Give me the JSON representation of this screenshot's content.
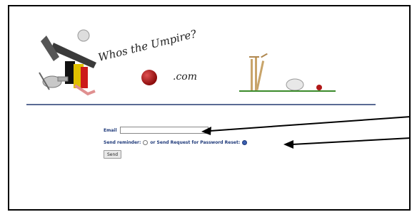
{
  "header": {
    "site_name": "Whos the Umpire?",
    "site_tld": ".com"
  },
  "form": {
    "email_label": "Email",
    "email_value": "",
    "send_reminder_label": "Send reminder:",
    "or_label": "or Send Request for Password Reset:",
    "send_reminder_selected": false,
    "reset_selected": true,
    "send_button_label": "Send"
  },
  "colors": {
    "form_text": "#1f3a7a",
    "divider": "#5a6a94",
    "ball": "#8b0b0b"
  }
}
